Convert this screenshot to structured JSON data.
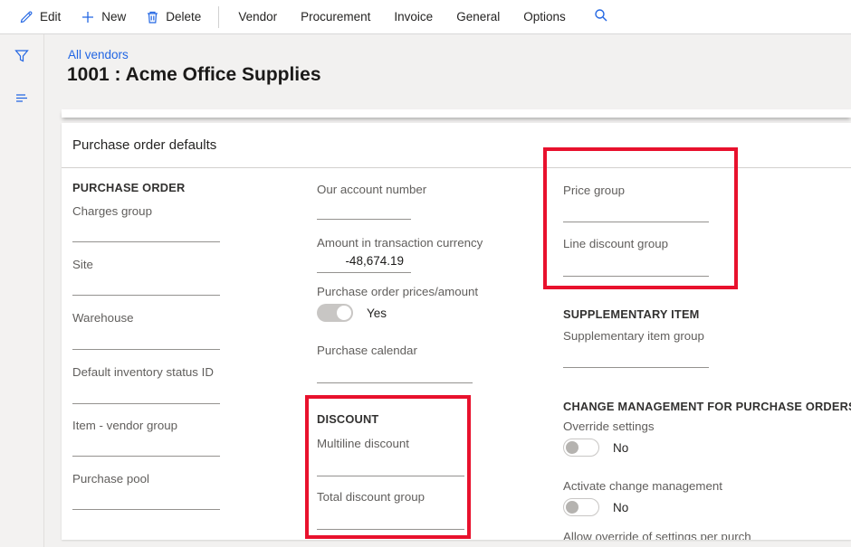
{
  "toolbar": {
    "edit_label": "Edit",
    "new_label": "New",
    "delete_label": "Delete",
    "tabs": [
      {
        "label": "Vendor"
      },
      {
        "label": "Procurement"
      },
      {
        "label": "Invoice"
      },
      {
        "label": "General"
      },
      {
        "label": "Options"
      }
    ]
  },
  "header": {
    "breadcrumb": "All vendors",
    "title": "1001 : Acme Office Supplies"
  },
  "section": {
    "title": "Purchase order defaults"
  },
  "purchase_order_group": {
    "heading": "PURCHASE ORDER",
    "fields": [
      {
        "label": "Charges group",
        "value": ""
      },
      {
        "label": "Site",
        "value": ""
      },
      {
        "label": "Warehouse",
        "value": ""
      },
      {
        "label": "Default inventory status ID",
        "value": ""
      },
      {
        "label": "Item - vendor group",
        "value": ""
      },
      {
        "label": "Purchase pool",
        "value": ""
      }
    ]
  },
  "middle_column": {
    "our_account_number": {
      "label": "Our account number",
      "value": ""
    },
    "amount_in_transaction_currency": {
      "label": "Amount in transaction currency",
      "value": "-48,674.19"
    },
    "purchase_order_prices_amount": {
      "label": "Purchase order prices/amount",
      "state": "Yes"
    },
    "purchase_calendar": {
      "label": "Purchase calendar",
      "value": ""
    }
  },
  "discount_group": {
    "heading": "DISCOUNT",
    "fields": [
      {
        "label": "Multiline discount",
        "value": ""
      },
      {
        "label": "Total discount group",
        "value": ""
      }
    ]
  },
  "right_column": {
    "price_group": {
      "label": "Price group",
      "value": ""
    },
    "line_discount_group": {
      "label": "Line discount group",
      "value": ""
    },
    "supplementary_heading": "SUPPLEMENTARY ITEM",
    "supplementary_item_group": {
      "label": "Supplementary item group",
      "value": ""
    },
    "change_mgmt_heading": "CHANGE MANAGEMENT FOR PURCHASE ORDERS",
    "override_settings": {
      "label": "Override settings",
      "state": "No"
    },
    "activate_change_management": {
      "label": "Activate change management",
      "state": "No"
    },
    "allow_override": {
      "label": "Allow override of settings per purch"
    }
  },
  "colors": {
    "accent_blue": "#2266e3",
    "highlight_red": "#e8112d",
    "toggle_on_fill": "#c8c6c4",
    "label_gray": "#605e5c"
  }
}
